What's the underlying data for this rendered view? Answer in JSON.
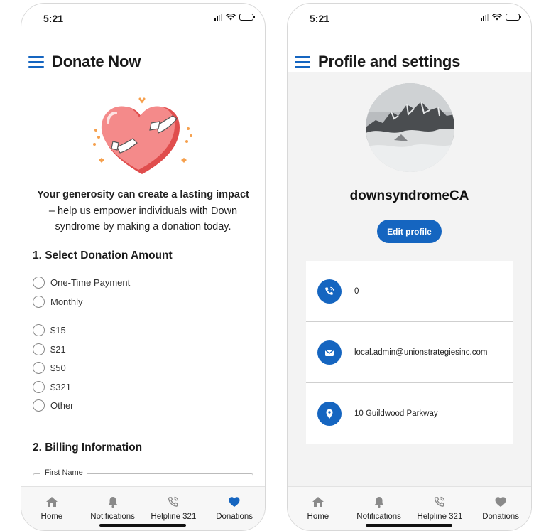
{
  "left_screen": {
    "status": {
      "time": "5:21"
    },
    "title": "Donate Now",
    "intro_bold": "Your generosity can create a lasting impact",
    "intro_rest": " – help us empower individuals with Down syndrome by making a donation today.",
    "section1_title": "1. Select Donation Amount",
    "frequency_options": [
      "One-Time Payment",
      "Monthly"
    ],
    "amount_options": [
      "$15",
      "$21",
      "$50",
      "$321",
      "Other"
    ],
    "section2_title": "2. Billing Information",
    "first_name_label": "First Name"
  },
  "right_screen": {
    "status": {
      "time": "5:21"
    },
    "title": "Profile and settings",
    "username": "downsyndromeCA",
    "edit_profile_label": "Edit profile",
    "phone_value": "0",
    "email_value": "local.admin@unionstrategiesinc.com",
    "address_value": "10 Guildwood Parkway"
  },
  "tabbar": {
    "items": [
      {
        "label": "Home",
        "icon": "home-icon"
      },
      {
        "label": "Notifications",
        "icon": "bell-icon"
      },
      {
        "label": "Helpline 321",
        "icon": "phone-call-icon"
      },
      {
        "label": "Donations",
        "icon": "heart-icon"
      }
    ]
  },
  "colors": {
    "accent": "#1565c0",
    "inactive_icon": "#8a8a8a",
    "heart": "#f26b6b",
    "heart_shadow": "#e04d4d"
  }
}
